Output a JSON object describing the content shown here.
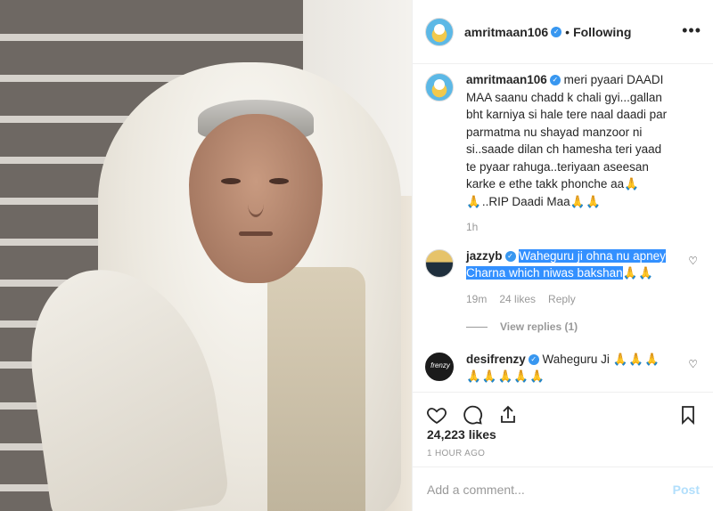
{
  "header": {
    "username": "amritmaan106",
    "separator": "•",
    "follow_status": "Following",
    "more_icon": "•••"
  },
  "icons": {
    "verified": "verified-badge",
    "like": "heart-icon",
    "comment": "comment-icon",
    "share": "share-icon",
    "save": "bookmark-icon",
    "more": "more-options-icon"
  },
  "caption": {
    "username": "amritmaan106",
    "text": "meri pyaari DAADI MAA saanu chadd k chali gyi...gallan bht karniya si hale tere naal daadi par parmatma nu shayad manzoor ni si..saade dilan ch hamesha teri yaad te pyaar rahuga..teriyaan aseesan karke e ethe takk phonche aa",
    "emoji_a": "🙏🙏",
    "text_b": "..RIP Daadi Maa",
    "emoji_b": "🙏🙏",
    "time": "1h"
  },
  "comments": [
    {
      "username": "jazzyb",
      "text": "Waheguru ji ohna nu apney Charna which niwas bakshan",
      "emoji": "🙏🙏",
      "time": "19m",
      "likes": "24 likes",
      "reply": "Reply",
      "view_replies": "View replies (1)"
    },
    {
      "username": "desifrenzy",
      "text": "Waheguru Ji",
      "emoji": "🙏🙏🙏🙏🙏🙏🙏🙏",
      "avatar_text": "frenzy"
    }
  ],
  "stats": {
    "likes": "24,223 likes",
    "time_ago": "1 HOUR AGO"
  },
  "composer": {
    "placeholder": "Add a comment...",
    "post_label": "Post"
  },
  "colors": {
    "verified": "#3897f0",
    "highlight": "#3390ff",
    "muted": "#999999",
    "post_disabled": "#b2dffc"
  }
}
